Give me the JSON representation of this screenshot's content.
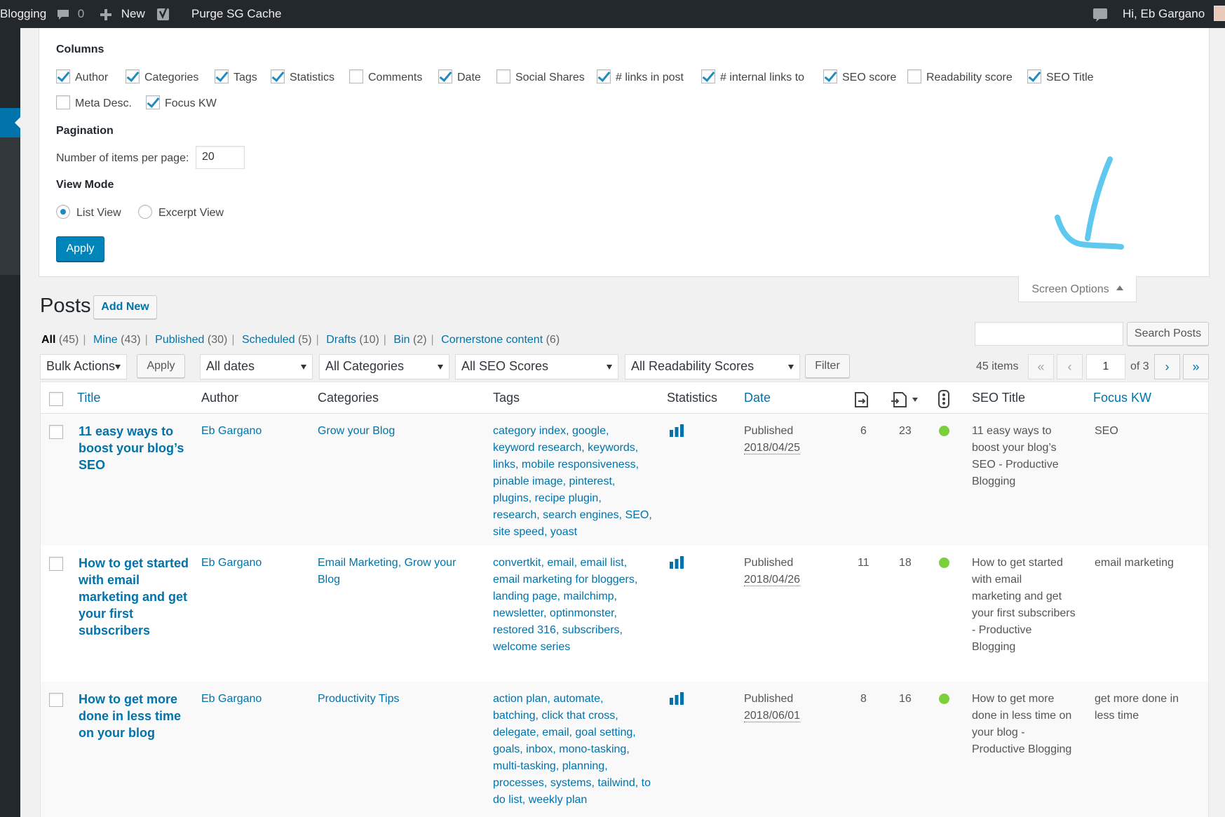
{
  "admin_bar": {
    "site_name": "Blogging",
    "comments_count": "0",
    "new_label": "New",
    "purge_label": "Purge SG Cache",
    "greeting": "Hi, Eb Gargano"
  },
  "screen_options": {
    "columns_heading": "Columns",
    "columns": [
      {
        "label": "Author",
        "checked": true
      },
      {
        "label": "Categories",
        "checked": true
      },
      {
        "label": "Tags",
        "checked": true
      },
      {
        "label": "Statistics",
        "checked": true
      },
      {
        "label": "Comments",
        "checked": false
      },
      {
        "label": "Date",
        "checked": true
      },
      {
        "label": "Social Shares",
        "checked": false
      },
      {
        "label": "# links in post",
        "checked": true
      },
      {
        "label": "# internal links to",
        "checked": true
      },
      {
        "label": "SEO score",
        "checked": true
      },
      {
        "label": "Readability score",
        "checked": false
      },
      {
        "label": "SEO Title",
        "checked": true
      },
      {
        "label": "Meta Desc.",
        "checked": false
      },
      {
        "label": "Focus KW",
        "checked": true
      }
    ],
    "pagination_heading": "Pagination",
    "items_per_page_label": "Number of items per page:",
    "items_per_page_value": "20",
    "view_mode_heading": "View Mode",
    "view_modes": [
      {
        "label": "List View",
        "selected": true
      },
      {
        "label": "Excerpt View",
        "selected": false
      }
    ],
    "apply_label": "Apply",
    "tab_label": "Screen Options"
  },
  "page": {
    "title": "Posts",
    "add_new_label": "Add New"
  },
  "views": [
    {
      "label": "All",
      "count": "(45)",
      "current": true
    },
    {
      "label": "Mine",
      "count": "(43)"
    },
    {
      "label": "Published",
      "count": "(30)"
    },
    {
      "label": "Scheduled",
      "count": "(5)"
    },
    {
      "label": "Drafts",
      "count": "(10)"
    },
    {
      "label": "Bin",
      "count": "(2)"
    },
    {
      "label": "Cornerstone content",
      "count": "(6)"
    }
  ],
  "search": {
    "button_label": "Search Posts",
    "placeholder": ""
  },
  "filters": {
    "bulk_actions": "Bulk Actions",
    "bulk_apply": "Apply",
    "dates": "All dates",
    "categories": "All Categories",
    "seo_scores": "All SEO Scores",
    "readability": "All Readability Scores",
    "filter_label": "Filter"
  },
  "pagination": {
    "items_label": "45 items",
    "first": "«",
    "prev": "‹",
    "current_page": "1",
    "of_label": "of 3",
    "next": "›",
    "last": "»"
  },
  "table": {
    "headers": {
      "title": "Title",
      "author": "Author",
      "categories": "Categories",
      "tags": "Tags",
      "statistics": "Statistics",
      "date": "Date",
      "seo_title": "SEO Title",
      "focus_kw": "Focus KW"
    },
    "rows": [
      {
        "title_lines": [
          "11 easy ways to",
          "boost your blog’s",
          "SEO"
        ],
        "author": "Eb Gargano",
        "categories_lines": [
          "Grow your Blog"
        ],
        "tags_lines": [
          "category index, google,",
          "keyword research, keywords,",
          "links, mobile responsiveness,",
          "pinable image, pinterest,",
          "plugins, recipe plugin,",
          "research, search engines, SEO,",
          "site speed, yoast"
        ],
        "status": "Published",
        "date": "2018/04/25",
        "links_in_post": "6",
        "internal_links": "23",
        "seo_score_color": "#7ad03a",
        "seo_title_lines": [
          "11 easy ways to",
          "boost your blog’s",
          "SEO - Productive",
          "Blogging"
        ],
        "focus_kw_lines": [
          "SEO"
        ]
      },
      {
        "title_lines": [
          "How to get started",
          "with email",
          "marketing and get",
          "your first",
          "subscribers"
        ],
        "author": "Eb Gargano",
        "categories_lines": [
          "Email Marketing, Grow your",
          "Blog"
        ],
        "tags_lines": [
          "convertkit, email, email list,",
          "email marketing for bloggers,",
          "landing page, mailchimp,",
          "newsletter, optinmonster,",
          "restored 316, subscribers,",
          "welcome series"
        ],
        "status": "Published",
        "date": "2018/04/26",
        "links_in_post": "11",
        "internal_links": "18",
        "seo_score_color": "#7ad03a",
        "seo_title_lines": [
          "How to get started",
          "with email",
          "marketing and get",
          "your first subscribers",
          "- Productive",
          "Blogging"
        ],
        "focus_kw_lines": [
          "email marketing"
        ]
      },
      {
        "title_lines": [
          "How to get more",
          "done in less time",
          "on your blog"
        ],
        "author": "Eb Gargano",
        "categories_lines": [
          "Productivity Tips"
        ],
        "tags_lines": [
          "action plan, automate,",
          "batching, click that cross,",
          "delegate, email, goal setting,",
          "goals, inbox, mono-tasking,",
          "multi-tasking, planning,",
          "processes, systems, tailwind, to",
          "do list, weekly plan"
        ],
        "status": "Published",
        "date": "2018/06/01",
        "links_in_post": "8",
        "internal_links": "16",
        "seo_score_color": "#7ad03a",
        "seo_title_lines": [
          "How to get more",
          "done in less time on",
          "your blog -",
          "Productive Blogging"
        ],
        "focus_kw_lines": [
          "get more done in",
          "less time"
        ]
      }
    ]
  },
  "colors": {
    "admin_bar": "#23282d",
    "link": "#0073aa",
    "primary_button": "#0085ba",
    "seo_good": "#7ad03a",
    "annotation_arrow": "#5ec8ef"
  }
}
